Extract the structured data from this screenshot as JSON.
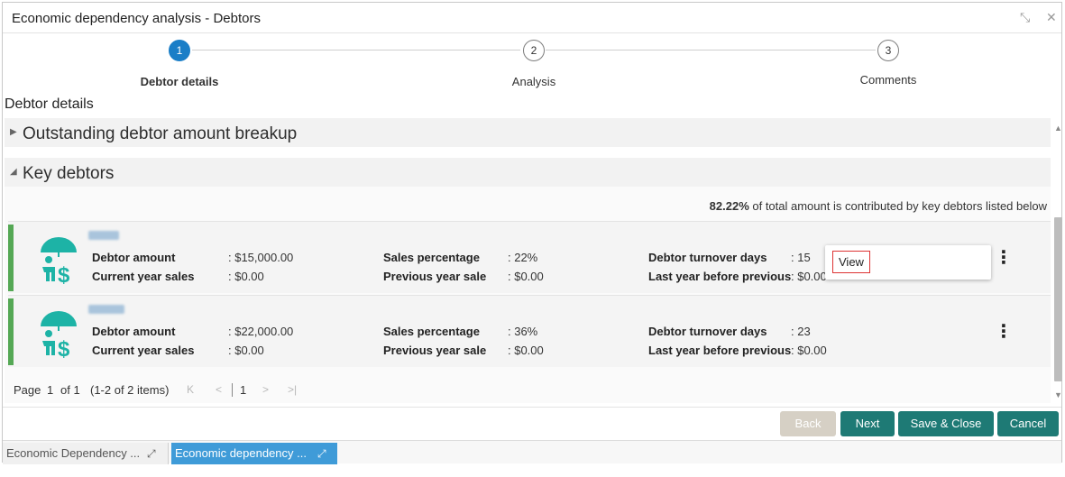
{
  "window": {
    "title": "Economic dependency analysis - Debtors",
    "restore_glyph": "⤡",
    "close_glyph": "✕"
  },
  "stepper": {
    "steps": [
      {
        "number": "1",
        "label": "Debtor details",
        "state": "active"
      },
      {
        "number": "2",
        "label": "Analysis",
        "state": "pending"
      },
      {
        "number": "3",
        "label": "Comments",
        "state": "pending"
      }
    ]
  },
  "section": {
    "title": "Debtor details"
  },
  "panels": {
    "outstanding": {
      "title": "Outstanding debtor amount breakup",
      "expanded": false,
      "arrow": "▶"
    },
    "key_debtors": {
      "title": "Key debtors",
      "expanded": true,
      "arrow": "◢"
    }
  },
  "summary": {
    "percent": "82.22%",
    "text": " of total amount is contributed by key debtors listed below"
  },
  "debtors": [
    {
      "debtor_amount_label": "Debtor amount",
      "debtor_amount": ": $15,000.00",
      "current_year_sales_label": "Current year sales",
      "current_year_sales": ": $0.00",
      "sales_percentage_label": "Sales percentage",
      "sales_percentage": ":  22%",
      "previous_year_sale_label": "Previous year sale",
      "previous_year_sale": ":  $0.00",
      "turnover_days_label": "Debtor turnover days",
      "turnover_days": ":  15",
      "last_year_label": "Last year before previous",
      "last_year": ":  $0.00"
    },
    {
      "debtor_amount_label": "Debtor amount",
      "debtor_amount": ": $22,000.00",
      "current_year_sales_label": "Current year sales",
      "current_year_sales": ": $0.00",
      "sales_percentage_label": "Sales percentage",
      "sales_percentage": ":  36%",
      "previous_year_sale_label": "Previous year sale",
      "previous_year_sale": ":  $0.00",
      "turnover_days_label": "Debtor turnover days",
      "turnover_days": ":  23",
      "last_year_label": "Last year before previous",
      "last_year": ":  $0.00"
    }
  ],
  "row_menu": {
    "view_label": "View",
    "kebab_glyph": "⋮"
  },
  "pager": {
    "page_label": "Page",
    "page_number": "1",
    "of_label": "of 1",
    "items_label": "(1-2 of 2 items)",
    "first": "K",
    "prev": "<",
    "current": "1",
    "next": ">",
    "last": ">|"
  },
  "footer": {
    "back": "Back",
    "next": "Next",
    "save_close": "Save & Close",
    "cancel": "Cancel"
  },
  "taskbar": {
    "tasks": [
      {
        "label": "Economic Dependency ...",
        "active": false
      },
      {
        "label": "Economic dependency ...",
        "active": true
      }
    ],
    "expand_glyph": "⤢"
  },
  "colors": {
    "accent_blue": "#1a7ec7",
    "teal": "#1e7a75",
    "row_accent_green": "#55a855",
    "logo_teal": "#1db3a6"
  }
}
